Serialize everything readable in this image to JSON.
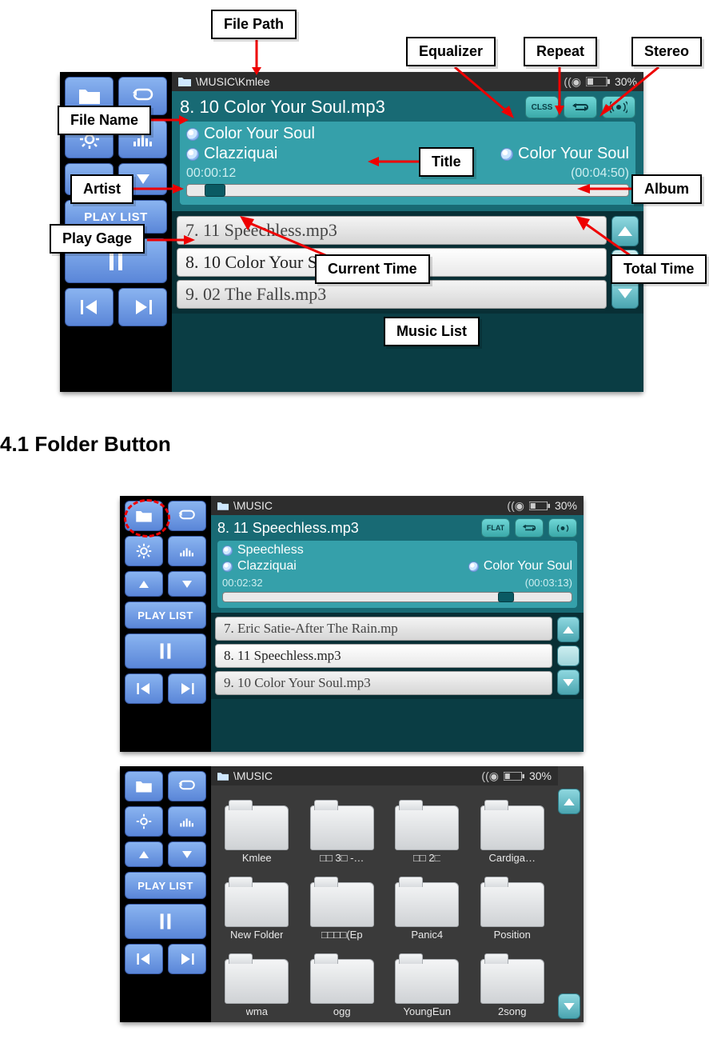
{
  "labels": {
    "file_path": "File Path",
    "file_name": "File Name",
    "equalizer": "Equalizer",
    "repeat": "Repeat",
    "stereo": "Stereo",
    "title": "Title",
    "artist": "Artist",
    "album": "Album",
    "play_gage": "Play Gage",
    "current_time": "Current Time",
    "total_time": "Total Time",
    "music_list": "Music List"
  },
  "section_heading": "4.1 Folder Button",
  "sidebar_text": {
    "playlist": "PLAY LIST"
  },
  "player1": {
    "path": "\\MUSIC\\Kmlee",
    "battery": "30%",
    "file_name": "8. 10 Color Your Soul.mp3",
    "eq_badge": "CLSS",
    "title": "Color Your Soul",
    "artist": "Clazziquai",
    "album": "Color Your Soul",
    "current": "00:00:12",
    "total": "(00:04:50)",
    "progress_percent": 4,
    "tracks": [
      "7. 11 Speechless.mp3",
      "8. 10 Color Your Soul.mp3",
      "9. 02 The Falls.mp3"
    ],
    "current_index": 1
  },
  "player2": {
    "path": "\\MUSIC",
    "battery": "30%",
    "file_name": "8. 11 Speechless.mp3",
    "eq_badge": "FLAT",
    "title": "Speechless",
    "artist": "Clazziquai",
    "album": "Color Your Soul",
    "current": "00:02:32",
    "total": "(00:03:13)",
    "progress_percent": 79,
    "tracks": [
      "7. Eric Satie-After The Rain.mp",
      "8. 11 Speechless.mp3",
      "9. 10 Color Your Soul.mp3"
    ],
    "current_index": 1
  },
  "player3": {
    "path": "\\MUSIC",
    "battery": "30%",
    "folders": [
      "Kmlee",
      "□□ 3□ -…",
      "□□ 2□",
      "Cardiga…",
      "New Folder",
      "□□□□(Ep",
      "Panic4",
      "Position",
      "wma",
      "ogg",
      "YoungEun",
      "2song"
    ]
  }
}
